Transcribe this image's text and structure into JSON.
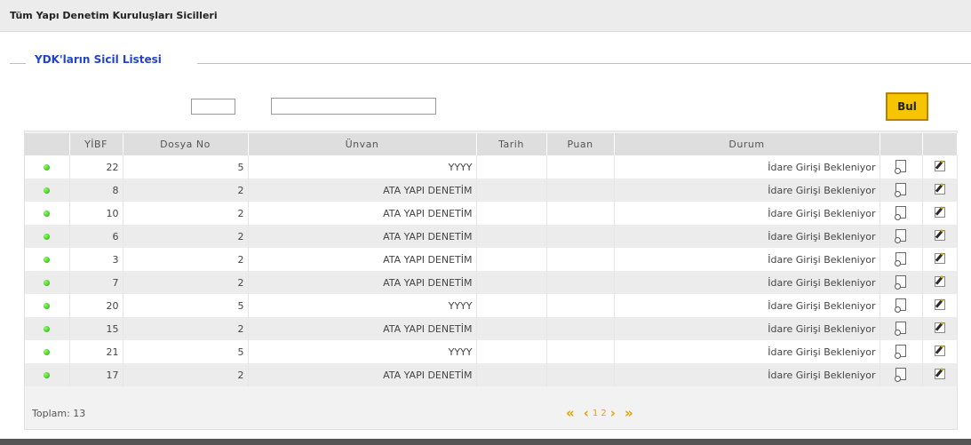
{
  "page": {
    "title": "Tüm Yapı Denetim Kuruluşları Sicilleri"
  },
  "section": {
    "title": "YDK'ların Sicil Listesi"
  },
  "filters": {
    "small_value": "",
    "large_value": ""
  },
  "search_button": {
    "label": "Bul"
  },
  "table": {
    "columns": [
      "",
      "YİBF",
      "Dosya No",
      "Ünvan",
      "Tarih",
      "Puan",
      "Durum",
      "",
      ""
    ],
    "rows": [
      {
        "yibf": "22",
        "dosya_no": "5",
        "unvan": "YYYY",
        "tarih": "",
        "puan": "",
        "durum": "İdare Girişi Bekleniyor"
      },
      {
        "yibf": "8",
        "dosya_no": "2",
        "unvan": "ATA YAPI DENETİM",
        "tarih": "",
        "puan": "",
        "durum": "İdare Girişi Bekleniyor"
      },
      {
        "yibf": "10",
        "dosya_no": "2",
        "unvan": "ATA YAPI DENETİM",
        "tarih": "",
        "puan": "",
        "durum": "İdare Girişi Bekleniyor"
      },
      {
        "yibf": "6",
        "dosya_no": "2",
        "unvan": "ATA YAPI DENETİM",
        "tarih": "",
        "puan": "",
        "durum": "İdare Girişi Bekleniyor"
      },
      {
        "yibf": "3",
        "dosya_no": "2",
        "unvan": "ATA YAPI DENETİM",
        "tarih": "",
        "puan": "",
        "durum": "İdare Girişi Bekleniyor"
      },
      {
        "yibf": "7",
        "dosya_no": "2",
        "unvan": "ATA YAPI DENETİM",
        "tarih": "",
        "puan": "",
        "durum": "İdare Girişi Bekleniyor"
      },
      {
        "yibf": "20",
        "dosya_no": "5",
        "unvan": "YYYY",
        "tarih": "",
        "puan": "",
        "durum": "İdare Girişi Bekleniyor"
      },
      {
        "yibf": "15",
        "dosya_no": "2",
        "unvan": "ATA YAPI DENETİM",
        "tarih": "",
        "puan": "",
        "durum": "İdare Girişi Bekleniyor"
      },
      {
        "yibf": "21",
        "dosya_no": "5",
        "unvan": "YYYY",
        "tarih": "",
        "puan": "",
        "durum": "İdare Girişi Bekleniyor"
      },
      {
        "yibf": "17",
        "dosya_no": "2",
        "unvan": "ATA YAPI DENETİM",
        "tarih": "",
        "puan": "",
        "durum": "İdare Girişi Bekleniyor"
      }
    ],
    "status_icon": "green-dot-icon",
    "view_icon": "view-document-icon",
    "edit_icon": "edit-icon",
    "status_color": "#22b000"
  },
  "footer": {
    "total": "Toplam: 13"
  },
  "pager": {
    "first": "«",
    "prev": "‹",
    "pages": "1 2",
    "next": "›",
    "last": "»",
    "accent": "#e0a500"
  }
}
